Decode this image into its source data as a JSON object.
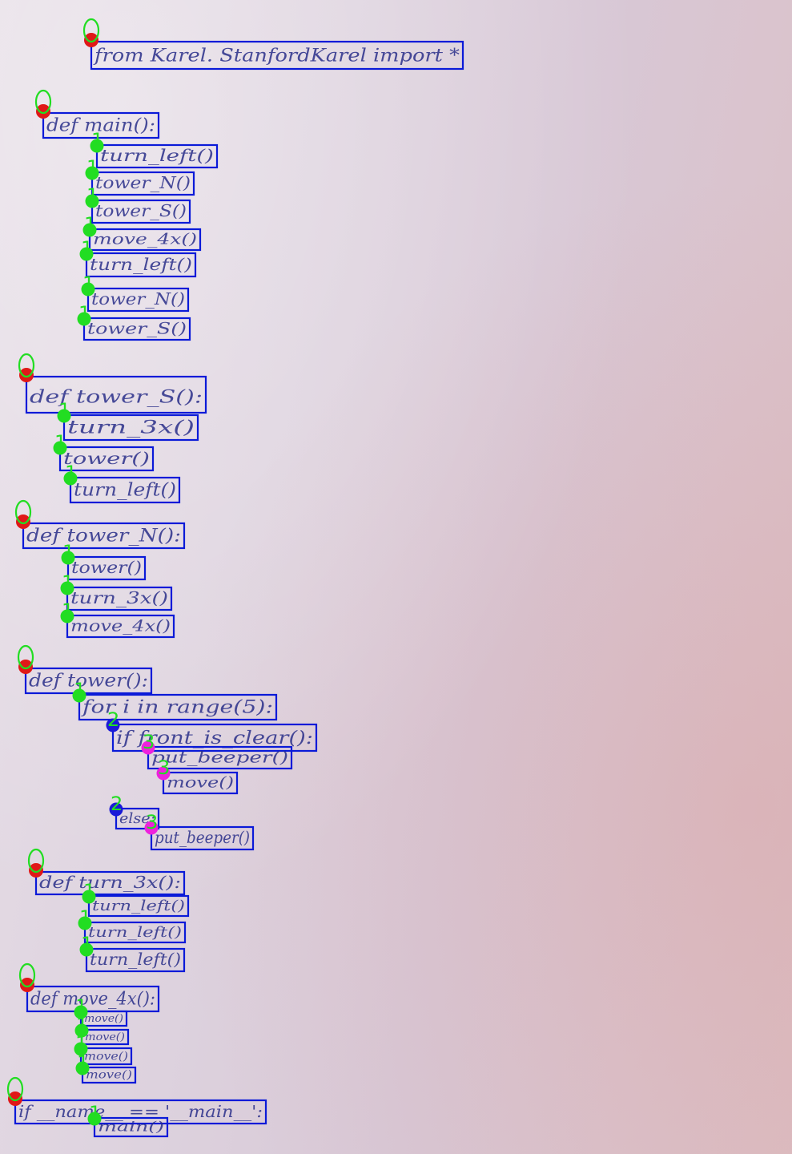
{
  "colors": {
    "box": "#0a1ad8",
    "depth0_dot": "#e01818",
    "depth0_label": "#22dd22",
    "depth1": "#22dd22",
    "depth2": "#1a1ad8",
    "depth2_label": "#22dd22",
    "depth3": "#ee22dd",
    "depth3_label": "#22dd22",
    "ink": "#2a2f8a"
  },
  "lines": [
    {
      "text": "from   Karel. StanfordKarel  import *",
      "depth": 0
    },
    {
      "text": "def  main():",
      "depth": 0
    },
    {
      "text": "turn_left()",
      "depth": 1
    },
    {
      "text": "tower_N()",
      "depth": 1
    },
    {
      "text": "tower_S()",
      "depth": 1
    },
    {
      "text": "move_4x()",
      "depth": 1
    },
    {
      "text": "turn_left()",
      "depth": 1
    },
    {
      "text": "tower_N()",
      "depth": 1
    },
    {
      "text": "tower_S()",
      "depth": 1
    },
    {
      "text": "def  tower_S():",
      "depth": 0
    },
    {
      "text": "turn_3x()",
      "depth": 1
    },
    {
      "text": "tower()",
      "depth": 1
    },
    {
      "text": "turn_left()",
      "depth": 1
    },
    {
      "text": "def  tower_N():",
      "depth": 0
    },
    {
      "text": "tower()",
      "depth": 1
    },
    {
      "text": "turn_3x()",
      "depth": 1
    },
    {
      "text": "move_4x()",
      "depth": 1
    },
    {
      "text": "def  tower():",
      "depth": 0
    },
    {
      "text": "for i in range(5):",
      "depth": 1
    },
    {
      "text": "if front_is_clear():",
      "depth": 2
    },
    {
      "text": "put_beeper()",
      "depth": 3
    },
    {
      "text": "move()",
      "depth": 3
    },
    {
      "text": "else:",
      "depth": 2
    },
    {
      "text": "put_beeper()",
      "depth": 3
    },
    {
      "text": "def turn_3x():",
      "depth": 0
    },
    {
      "text": "turn_left()",
      "depth": 1
    },
    {
      "text": "turn_left()",
      "depth": 1
    },
    {
      "text": "turn_left()",
      "depth": 1
    },
    {
      "text": "def  move_4x():",
      "depth": 0
    },
    {
      "text": "move()",
      "depth": 1
    },
    {
      "text": "move()",
      "depth": 1
    },
    {
      "text": "move()",
      "depth": 1
    },
    {
      "text": "move()",
      "depth": 1
    },
    {
      "text": "if __name__ == '__main__':",
      "depth": 0
    },
    {
      "text": "main()",
      "depth": 1
    }
  ]
}
